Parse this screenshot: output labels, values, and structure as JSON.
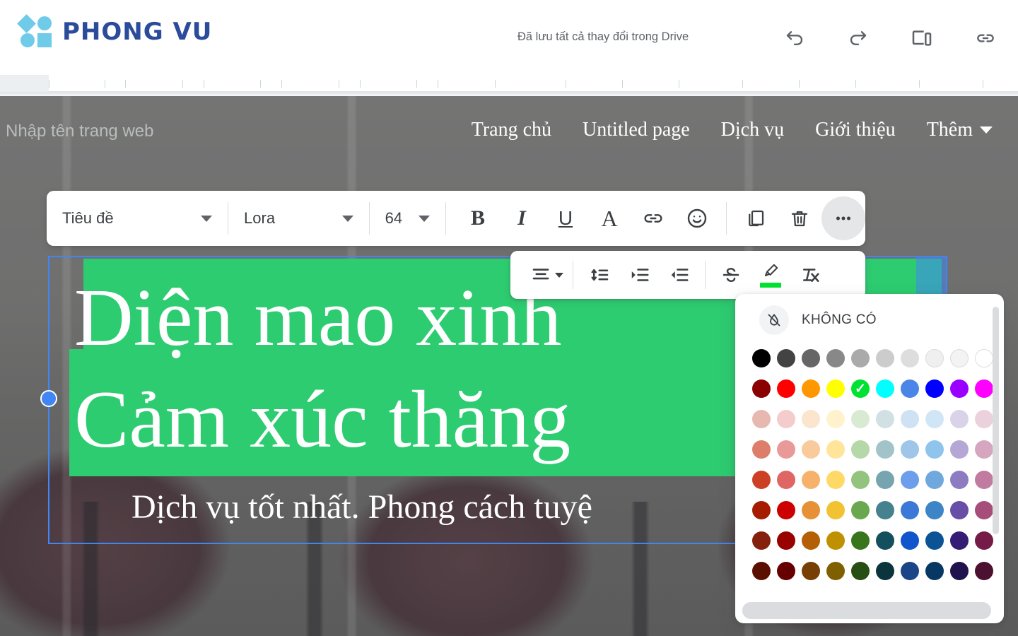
{
  "appbar": {
    "logo_text": "PHONG VU",
    "save_status": "Đã lưu tất cả thay đổi trong Drive",
    "icons": [
      "undo-icon",
      "redo-icon",
      "preview-icon",
      "link-icon"
    ]
  },
  "site": {
    "name_placeholder": "Nhập tên trang web",
    "nav": [
      {
        "label": "Trang chủ"
      },
      {
        "label": "Untitled page"
      },
      {
        "label": "Dịch vụ"
      },
      {
        "label": "Giới thiệu"
      },
      {
        "label": "Thêm"
      }
    ],
    "hero_line1": "Diện mao xinh",
    "hero_line2": "Cảm xúc thăng",
    "hero_sub": "Dịch vụ tốt nhất. Phong cách tuyệ",
    "highlight_color": "#2dcc70",
    "selection_color": "#4285f4"
  },
  "toolbar": {
    "style_value": "Tiêu đề",
    "font_value": "Lora",
    "size_value": "64",
    "bold_label": "B",
    "italic_label": "I",
    "underline_label": "U",
    "textcolor_label": "A",
    "items": [
      "bold-button",
      "italic-button",
      "underline-button",
      "text-color-button",
      "link-button",
      "emoji-button",
      "duplicate-button",
      "delete-button",
      "more-button"
    ]
  },
  "toolbar2": {
    "items": [
      "align-button",
      "line-spacing-button",
      "indent-increase-button",
      "indent-decrease-button",
      "strikethrough-button",
      "highlight-button",
      "clear-format-button"
    ],
    "highlight_swatch": "#00e232"
  },
  "color_picker": {
    "none_label": "KHÔNG CÓ",
    "none_icon": "no-color-icon",
    "selected": "#00e232",
    "rows": [
      [
        "#000000",
        "#434343",
        "#666666",
        "#888888",
        "#aaaaaa",
        "#cccccc",
        "#dddddd",
        "#efefef",
        "#f3f3f3",
        "#ffffff"
      ],
      [
        "#8b0000",
        "#ff0000",
        "#ff9800",
        "#ffff00",
        "#00e232",
        "#00ffff",
        "#4a86e8",
        "#0000ff",
        "#9900ff",
        "#ff00ff"
      ],
      [
        "#e6b8af",
        "#f4cccc",
        "#fce5cd",
        "#fff2cc",
        "#d9ead3",
        "#d0e0e3",
        "#cfe2f3",
        "#d0e6f7",
        "#d9d2e9",
        "#ead1dc"
      ],
      [
        "#dd7e6b",
        "#ea9999",
        "#f9cb9c",
        "#ffe599",
        "#b6d7a8",
        "#a2c4c9",
        "#9fc5e8",
        "#8fc5ec",
        "#b4a7d6",
        "#d5a6bd"
      ],
      [
        "#cc4125",
        "#e06666",
        "#f6b26b",
        "#ffd966",
        "#93c47d",
        "#76a5af",
        "#6d9eeb",
        "#6fa8dc",
        "#8e7cc3",
        "#c27ba0"
      ],
      [
        "#a61c00",
        "#cc0000",
        "#e69138",
        "#f1c232",
        "#6aa84f",
        "#45818e",
        "#3c78d8",
        "#3d85c6",
        "#674ea7",
        "#a64d79"
      ],
      [
        "#85200c",
        "#990000",
        "#b45f06",
        "#bf9000",
        "#38761d",
        "#134f5c",
        "#1155cc",
        "#0b5394",
        "#351c75",
        "#741b47"
      ],
      [
        "#5b0f00",
        "#660000",
        "#783f04",
        "#7f6000",
        "#274e13",
        "#0c343d",
        "#1c4587",
        "#073763",
        "#20124d",
        "#4c1130"
      ]
    ]
  }
}
